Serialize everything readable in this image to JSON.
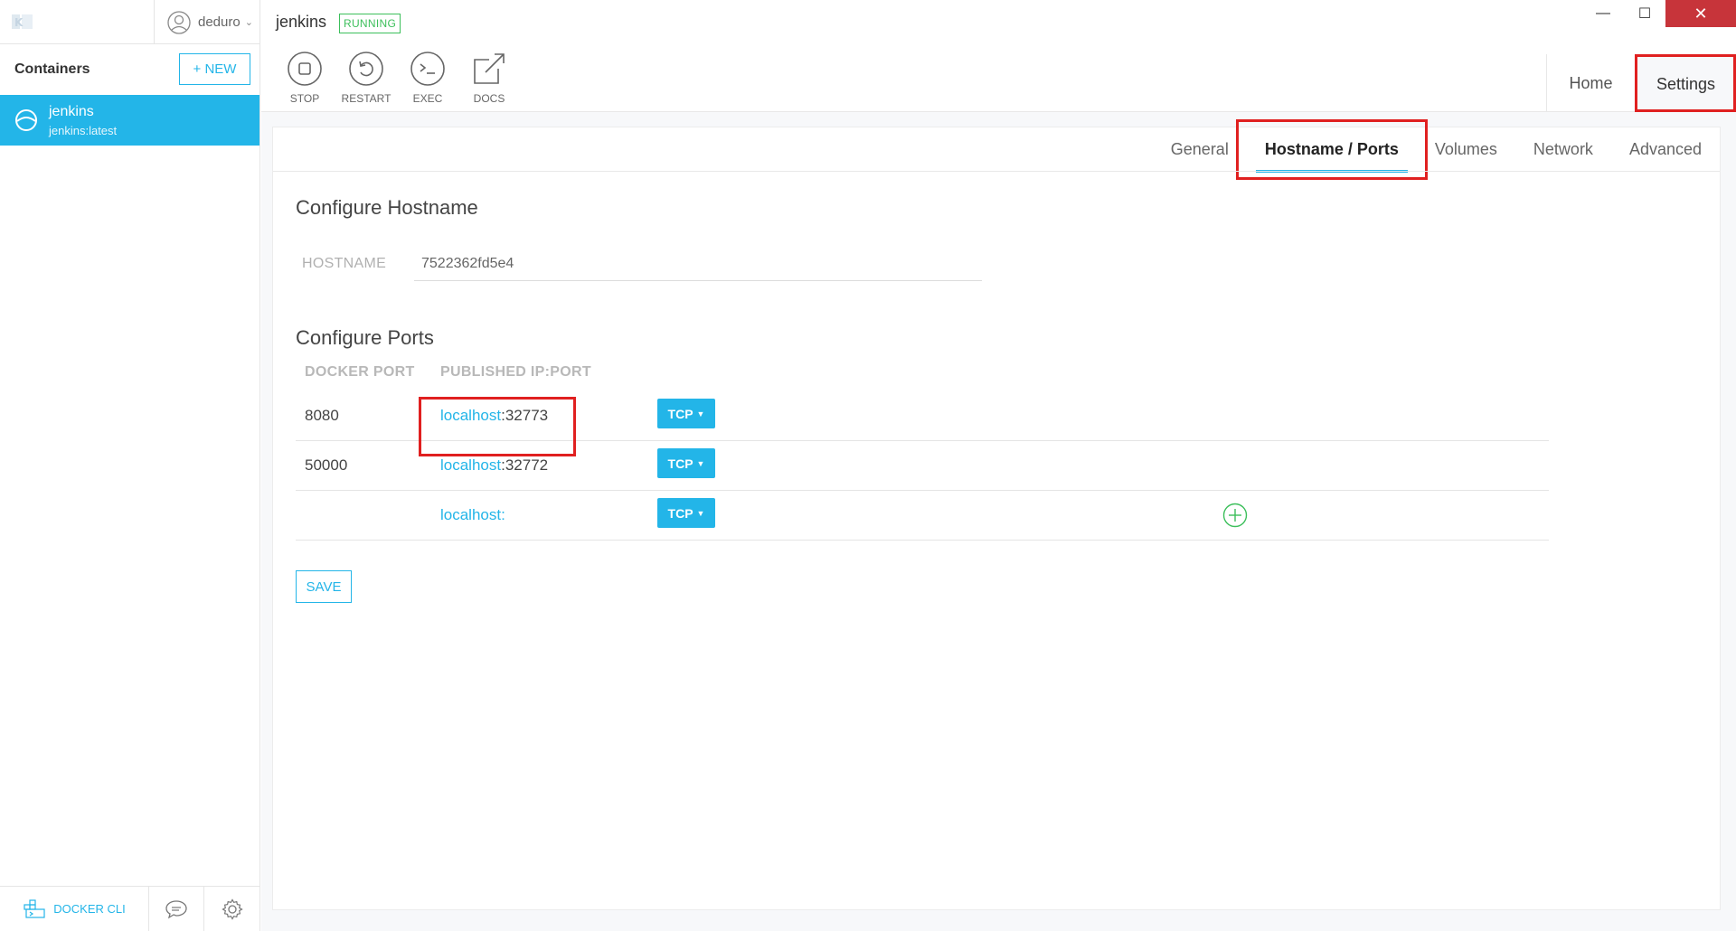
{
  "sidebar": {
    "user": "deduro",
    "title": "Containers",
    "new_button": "+ NEW",
    "container": {
      "name": "jenkins",
      "image": "jenkins:latest"
    },
    "bottom": {
      "docker_cli": "DOCKER CLI"
    }
  },
  "header": {
    "container_name": "jenkins",
    "status": "RUNNING",
    "actions": [
      "STOP",
      "RESTART",
      "EXEC",
      "DOCS"
    ],
    "view_tabs": {
      "home": "Home",
      "settings": "Settings"
    },
    "window_controls": {
      "minimize": "—",
      "maximize": "☐",
      "close": "✕"
    }
  },
  "settings": {
    "tabs": [
      "General",
      "Hostname / Ports",
      "Volumes",
      "Network",
      "Advanced"
    ],
    "active_tab": "Hostname / Ports",
    "hostname_section": {
      "title": "Configure Hostname",
      "label": "HOSTNAME",
      "value": "7522362fd5e4"
    },
    "ports_section": {
      "title": "Configure Ports",
      "columns": [
        "DOCKER PORT",
        "PUBLISHED IP:PORT"
      ],
      "rows": [
        {
          "docker_port": "8080",
          "host": "localhost",
          "port": ":32773",
          "protocol": "TCP"
        },
        {
          "docker_port": "50000",
          "host": "localhost",
          "port": ":32772",
          "protocol": "TCP"
        },
        {
          "docker_port": "",
          "host": "localhost",
          "port": ":",
          "protocol": "TCP"
        }
      ]
    },
    "save_button": "SAVE"
  },
  "colors": {
    "accent": "#23b5e8",
    "running": "#3cbf5b",
    "highlight": "#e02020",
    "close": "#c7343a"
  }
}
